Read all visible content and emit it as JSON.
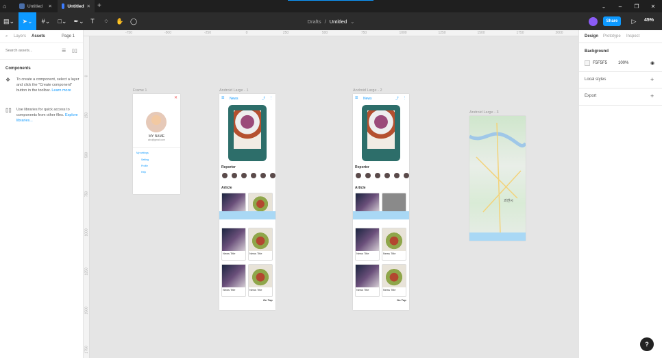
{
  "titlebar": {
    "tabs": [
      {
        "label": "Untitled"
      },
      {
        "label": "Untitled"
      }
    ]
  },
  "toolbar": {
    "breadcrumb_parent": "Drafts",
    "breadcrumb_sep": "/",
    "file_name": "Untitled",
    "share_label": "Share",
    "zoom": "45%"
  },
  "ruler": {
    "top": [
      "-750",
      "-500",
      "-250",
      "0",
      "250",
      "500",
      "750",
      "1000",
      "1250",
      "1500",
      "1750",
      "2000"
    ],
    "left": [
      "0",
      "250",
      "500",
      "750",
      "1000",
      "1250",
      "1500",
      "1750",
      "2000"
    ]
  },
  "left": {
    "tab_layers": "Layers",
    "tab_assets": "Assets",
    "page": "Page 1",
    "search_placeholder": "Search assets...",
    "components_title": "Components",
    "hint1": "To create a component, select a layer and click the \"Create component\" button in the toolbar.",
    "hint1_link": "Learn more",
    "hint2": "Use libraries for quick access to components from other files.",
    "hint2_link": "Explore libraries..."
  },
  "right": {
    "tab_design": "Design",
    "tab_prototype": "Prototype",
    "tab_inspect": "Inspect",
    "background_title": "Background",
    "bg_hex": "F5F5F5",
    "bg_opacity": "100%",
    "local_styles": "Local styles",
    "export": "Export"
  },
  "canvas": {
    "frame1": {
      "label": "Frame 1",
      "name": "MY NAME",
      "sub": "abc@gmail.com",
      "menu": [
        "My settings",
        "Setting",
        "Profile",
        "Help"
      ]
    },
    "android1": {
      "label": "Android Large - 1",
      "news": "News",
      "reporter": "Reporter",
      "article": "Article",
      "news_title": "News Title",
      "on_top": "On Top"
    },
    "android2": {
      "label": "Android Large - 2",
      "news": "News",
      "reporter": "Reporter",
      "article": "Article",
      "news_title": "News Title",
      "on_top": "On Top"
    },
    "android3": {
      "label": "Android Large - 3",
      "map_city": "과천시"
    }
  },
  "colors": {
    "accent": "#0d99ff",
    "toolbar": "#2c2c2c",
    "titlebar": "#1f1f1f",
    "canvas": "#e5e5e5"
  }
}
